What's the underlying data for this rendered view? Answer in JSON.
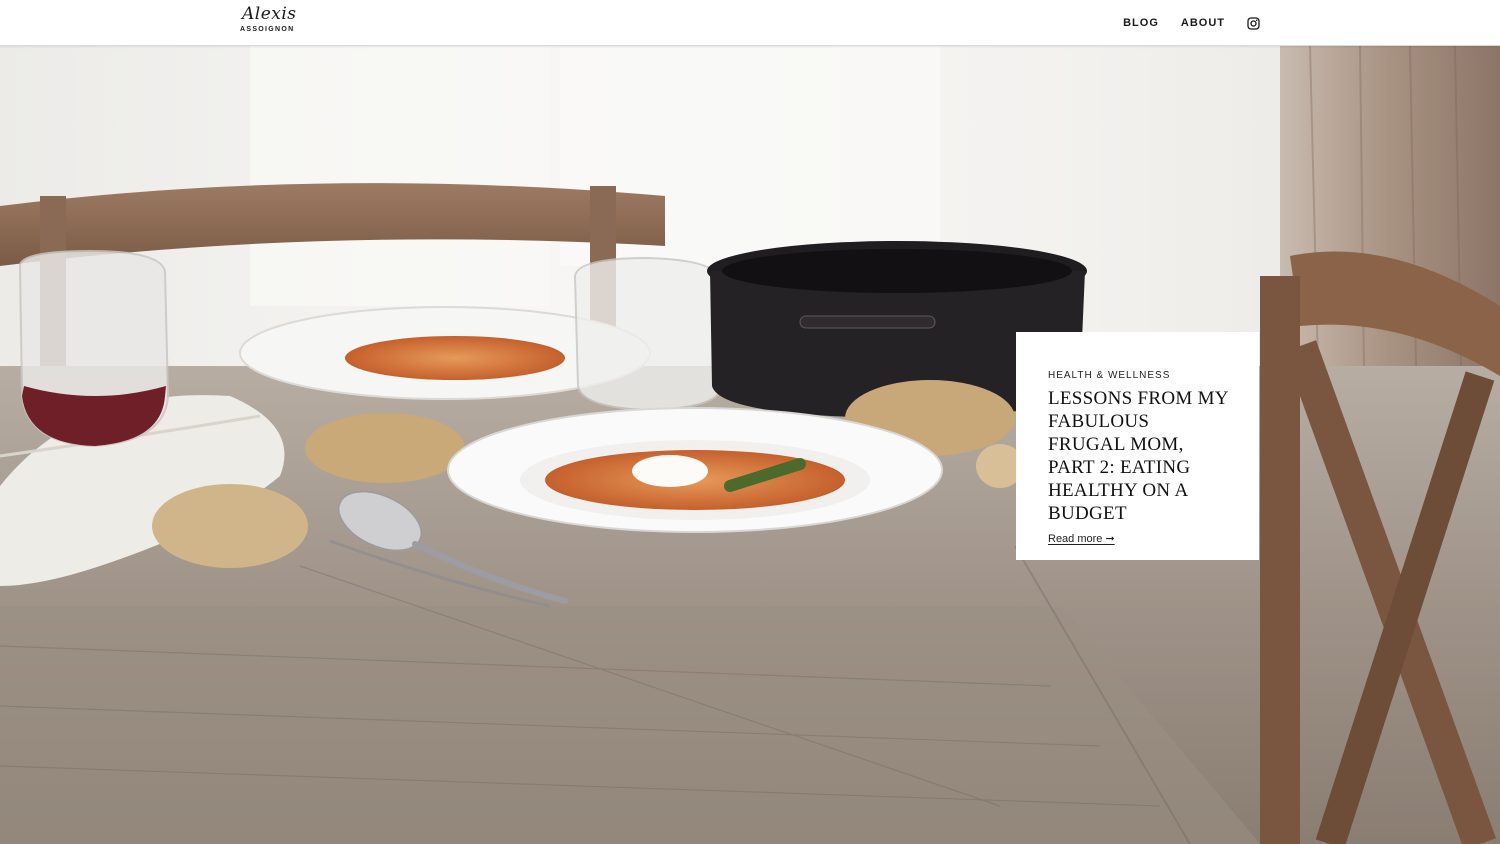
{
  "header": {
    "logo_script": "Alexis",
    "logo_sub": "ASSOIGNON",
    "nav": [
      {
        "label": "BLOG"
      },
      {
        "label": "ABOUT"
      }
    ],
    "social_icon": "instagram-icon"
  },
  "hero": {
    "image_description_icon": "photo"
  },
  "post": {
    "category": "HEALTH & WELLNESS",
    "title": "Lessons from my Fabulous Frugal Mom, Part 2: Eating Healthy on a Budget",
    "read_more": "Read more ➞"
  },
  "colors": {
    "header_bg": "#ffffff",
    "text": "#111111",
    "card_bg": "#ffffff",
    "wood": "#8a7a6c",
    "backdrop": "#f2f1ee"
  }
}
